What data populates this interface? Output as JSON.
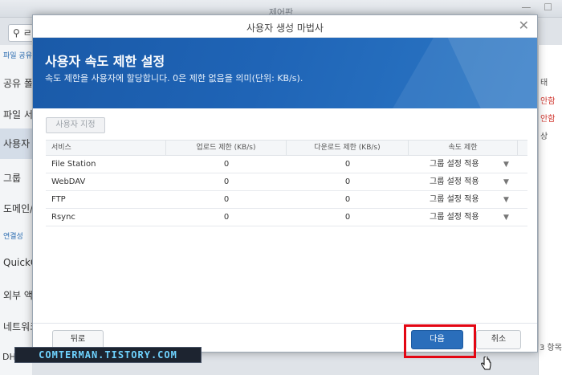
{
  "background": {
    "window_title": "제어판",
    "search_prefix": "ㄹ",
    "sidebar": [
      {
        "label": "파일 공유",
        "small": true
      },
      {
        "label": "공유 폴"
      },
      {
        "label": "파일 서"
      },
      {
        "label": "사용자",
        "active": true
      },
      {
        "label": "그룹"
      },
      {
        "label": "도메인/"
      },
      {
        "label": "연결성",
        "small": true
      },
      {
        "label": "QuickC"
      },
      {
        "label": "외부 액"
      },
      {
        "label": "네트워크"
      },
      {
        "label": "DH"
      }
    ],
    "right_cells": [
      "태",
      "안함",
      "안함",
      "상"
    ],
    "right_bottom": "3 항목"
  },
  "dialog": {
    "title": "사용자 생성 마법사",
    "heading": "사용자 속도 제한 설정",
    "description": "속도 제한을 사용자에 할당합니다. 0은 제한 없음을 의미(단위: KB/s).",
    "custom_button": "사용자 지정",
    "columns": [
      "서비스",
      "업로드 제한 (KB/s)",
      "다운로드 제한 (KB/s)",
      "속도 제한"
    ],
    "rows": [
      {
        "service": "File Station",
        "upload": "0",
        "download": "0",
        "limit": "그룹 설정 적용"
      },
      {
        "service": "WebDAV",
        "upload": "0",
        "download": "0",
        "limit": "그룹 설정 적용"
      },
      {
        "service": "FTP",
        "upload": "0",
        "download": "0",
        "limit": "그룹 설정 적용"
      },
      {
        "service": "Rsync",
        "upload": "0",
        "download": "0",
        "limit": "그룹 설정 적용"
      }
    ],
    "back_button": "뒤로",
    "next_button": "다음",
    "cancel_button": "취소"
  },
  "watermark": "COMTERMAN.TISTORY.COM",
  "colors": {
    "banner": "#1f64b6",
    "primary_button": "#2a6ebb",
    "highlight": "#e30613",
    "watermark_text": "#6fd3ff"
  }
}
